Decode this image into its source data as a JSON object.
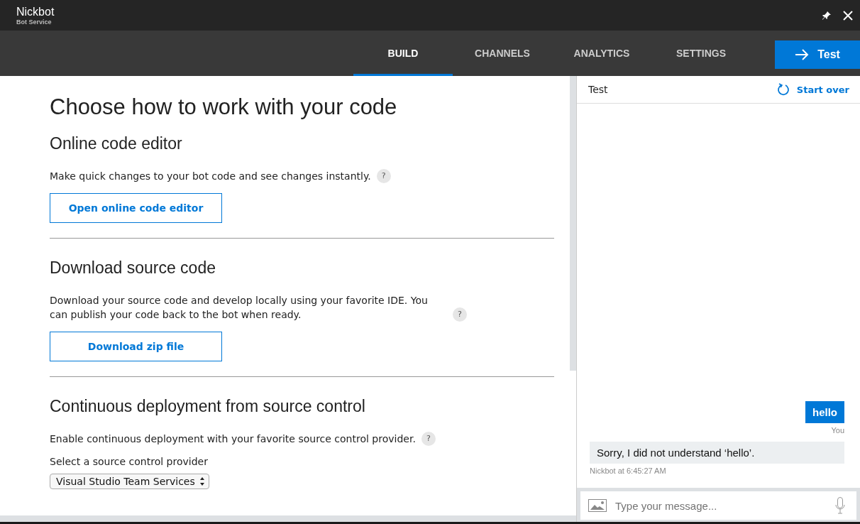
{
  "window": {
    "title": "Nickbot",
    "subtitle": "Bot Service"
  },
  "tabs": [
    {
      "label": "BUILD",
      "selected": true
    },
    {
      "label": "CHANNELS",
      "selected": false
    },
    {
      "label": "ANALYTICS",
      "selected": false
    },
    {
      "label": "SETTINGS",
      "selected": false
    }
  ],
  "test_button": "Test",
  "main": {
    "title": "Choose how to work with your code",
    "sections": [
      {
        "kind": "button",
        "heading": "Online code editor",
        "text": "Make quick changes to your bot code and see changes instantly.",
        "help": "?",
        "button": "Open online code editor"
      },
      {
        "kind": "button",
        "heading": "Download source code",
        "text": "Download your source code and develop locally using your favorite IDE. You can publish your code back to the bot when ready.",
        "help": "?",
        "button": "Download zip file"
      },
      {
        "kind": "select",
        "heading": "Continuous deployment from source control",
        "text": "Enable continuous deployment with your favorite source control provider.",
        "help": "?",
        "label": "Select a source control provider",
        "value": "Visual Studio Team Services"
      }
    ]
  },
  "chat": {
    "title": "Test",
    "start_over": "Start over",
    "messages": [
      {
        "kind": "user",
        "text": "hello",
        "meta": "You"
      },
      {
        "kind": "bot",
        "text": "Sorry, I did not understand ‘hello’.",
        "meta": "Nickbot at 6:45:27 AM"
      }
    ],
    "input": {
      "placeholder": "Type your message..."
    }
  }
}
